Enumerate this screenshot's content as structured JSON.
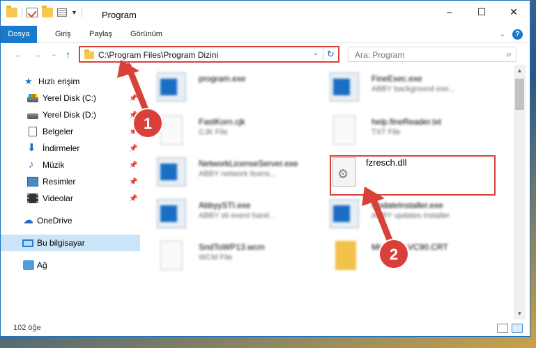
{
  "window": {
    "title": "Program",
    "controls": [
      "–",
      "☐",
      "✕"
    ]
  },
  "ribbon": {
    "tabs": [
      "Dosya",
      "Giriş",
      "Paylaş",
      "Görünüm"
    ],
    "expand_icon": "chevron-down-icon",
    "help": "?"
  },
  "nav": {
    "back": "←",
    "forward": "→",
    "recent": "⌄",
    "up": "↑",
    "address": "C:\\Program Files\\Program Dizini",
    "search_placeholder": "Ara: Program"
  },
  "sidebar": {
    "items": [
      {
        "label": "Hızlı erişim",
        "icon": "star-icon",
        "pinned": false
      },
      {
        "label": "Yerel Disk (C:)",
        "icon": "drive-c-icon",
        "pinned": true
      },
      {
        "label": "Yerel Disk (D:)",
        "icon": "drive-d-icon",
        "pinned": true
      },
      {
        "label": "Belgeler",
        "icon": "documents-icon",
        "pinned": true
      },
      {
        "label": "İndirmeler",
        "icon": "downloads-icon",
        "pinned": true
      },
      {
        "label": "Müzik",
        "icon": "music-icon",
        "pinned": true
      },
      {
        "label": "Resimler",
        "icon": "pictures-icon",
        "pinned": true
      },
      {
        "label": "Videolar",
        "icon": "videos-icon",
        "pinned": true
      },
      {
        "label": "OneDrive",
        "icon": "onedrive-icon",
        "pinned": false
      },
      {
        "label": "Bu bilgisayar",
        "icon": "this-pc-icon",
        "pinned": false,
        "selected": true
      },
      {
        "label": "Ağ",
        "icon": "network-icon",
        "pinned": false
      }
    ]
  },
  "files": {
    "left": [
      {
        "name": "program.exe",
        "desc": "",
        "type": "exe"
      },
      {
        "name": "FastKorn.cjk",
        "desc": "CJK File",
        "type": "doc"
      },
      {
        "name": "NetworkLicenseServer.exe",
        "desc": "ABBY network licens...",
        "type": "exe"
      },
      {
        "name": "AbbyySTI.exe",
        "desc": "ABBY sti event hand...",
        "type": "exe"
      },
      {
        "name": "SndToWP13.wcm",
        "desc": "WCM File",
        "type": "doc"
      }
    ],
    "right": [
      {
        "name": "FineExec.exe",
        "desc": "ABBY background exe...",
        "type": "exe"
      },
      {
        "name": "help.fineReader.txt",
        "desc": "TXT File",
        "type": "doc"
      },
      {
        "name": "fzresch.dll",
        "desc": "",
        "type": "dll",
        "highlighted": true
      },
      {
        "name": "UpdateInstaller.exe",
        "desc": "ABBY updates installer",
        "type": "exe"
      },
      {
        "name": "Microsoft.VC90.CRT",
        "desc": "",
        "type": "folder"
      }
    ]
  },
  "status": {
    "count": "102 öğe"
  },
  "annotations": {
    "step1": "1",
    "step2": "2",
    "color": "#d9403a"
  },
  "colors": {
    "accent": "#1979ca",
    "highlight": "#d9403a"
  }
}
